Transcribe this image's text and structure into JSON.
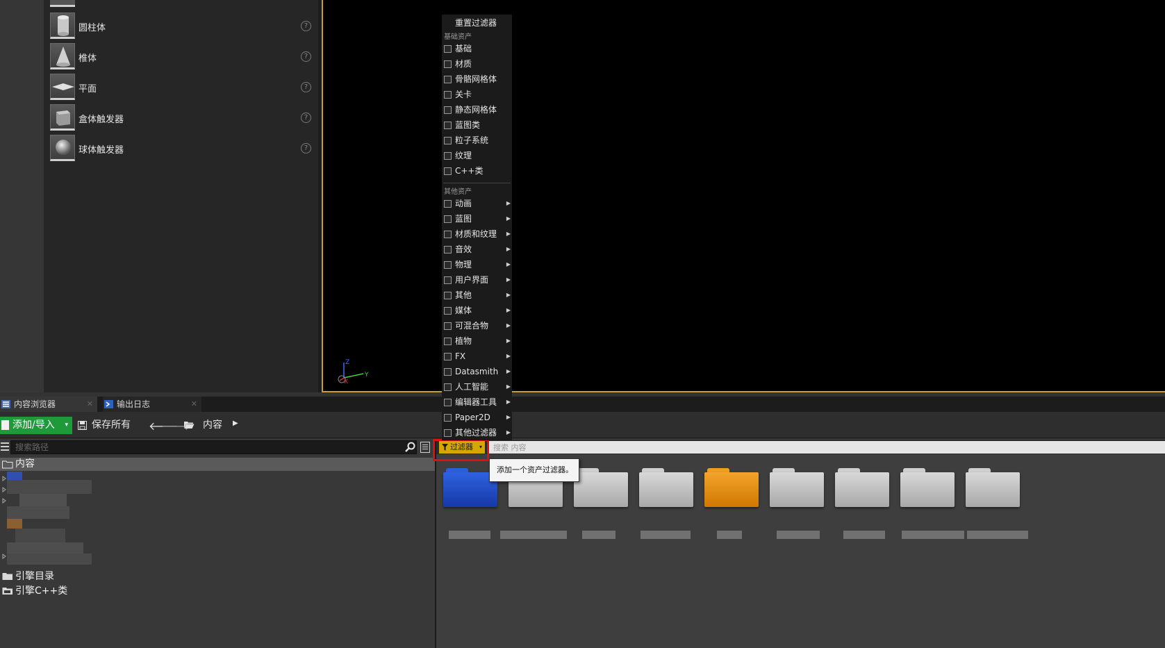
{
  "place_actors": {
    "items": [
      {
        "label": "圆柱体",
        "shape": "cylinder"
      },
      {
        "label": "椎体",
        "shape": "cone"
      },
      {
        "label": "平面",
        "shape": "plane"
      },
      {
        "label": "盒体触发器",
        "shape": "box-trigger"
      },
      {
        "label": "球体触发器",
        "shape": "sphere-trigger"
      }
    ],
    "help_glyph": "?"
  },
  "viewport": {
    "axis_labels": {
      "z": "Z",
      "y": "Y",
      "x": "X"
    },
    "border_color": "#c8a032"
  },
  "tabs": [
    {
      "label": "内容浏览器",
      "icon": "content-browser-icon",
      "close": "✕"
    },
    {
      "label": "输出日志",
      "icon": "output-log-icon",
      "close": "✕"
    }
  ],
  "toolbar": {
    "add_import_label": "添加/导入",
    "add_import_caret": "▾",
    "save_all_label": "保存所有",
    "back_glyph": "🡐",
    "forward_glyph": "🡒",
    "breadcrumb": "内容",
    "breadcrumb_arrow": "▶",
    "accent_color": "#1f9a3b"
  },
  "path_tree": {
    "search_placeholder": "搜索路径",
    "root_label": "内容",
    "bottom_items": [
      {
        "label": "引擎目录"
      },
      {
        "label": "引擎C++类"
      }
    ]
  },
  "asset_view": {
    "filters_label": "过滤器",
    "filters_caret": "▾",
    "search_placeholder": "搜索 内容",
    "tooltip": "添加一个资产过滤器。",
    "folders": [
      "blue",
      "grey",
      "grey",
      "grey",
      "orange",
      "grey",
      "grey",
      "grey",
      "grey"
    ],
    "filter_color": "#d4a800",
    "highlight_color": "#e01010"
  },
  "filter_menu": {
    "reset_label": "重置过滤器",
    "basic_heading": "基础资产",
    "basic_items": [
      "基础",
      "材质",
      "骨骼网格体",
      "关卡",
      "静态网格体",
      "蓝图类",
      "粒子系统",
      "纹理",
      "C++类"
    ],
    "other_heading": "其他资产",
    "other_items": [
      "动画",
      "蓝图",
      "材质和纹理",
      "音效",
      "物理",
      "用户界面",
      "其他",
      "媒体",
      "可混合物",
      "植物",
      "FX",
      "Datasmith",
      "人工智能",
      "编辑器工具",
      "Paper2D",
      "其他过滤器"
    ],
    "submenu_glyph": "▶"
  }
}
